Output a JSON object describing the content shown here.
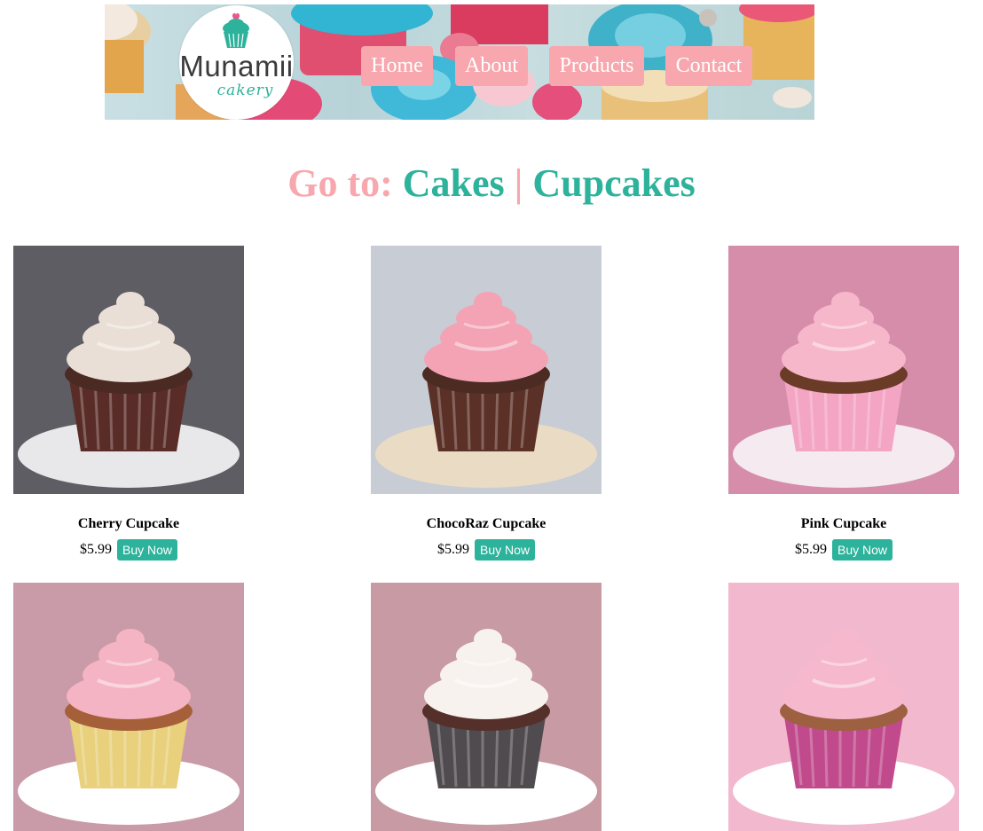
{
  "brand": {
    "name": "Munamii",
    "tagline": "cakery"
  },
  "nav": [
    {
      "label": "Home"
    },
    {
      "label": "About"
    },
    {
      "label": "Products"
    },
    {
      "label": "Contact"
    }
  ],
  "goto": {
    "prefix": "Go to:",
    "links": [
      "Cakes",
      "Cupcakes"
    ],
    "separator": "|"
  },
  "products": [
    {
      "name": "Cherry Cupcake",
      "price": "$5.99",
      "buy_label": "Buy Now",
      "bg": "#5e5d63",
      "frosting": "#eadfd6",
      "liner": "#5a2c27",
      "cake": "#4a2a22",
      "plate": "#e8e8ea"
    },
    {
      "name": "ChocoRaz Cupcake",
      "price": "$5.99",
      "buy_label": "Buy Now",
      "bg": "#c8ccd4",
      "frosting": "#f3a3b4",
      "liner": "#5b3026",
      "cake": "#4c2c22",
      "plate": "#eadcc4"
    },
    {
      "name": "Pink Cupcake",
      "price": "$5.99",
      "buy_label": "Buy Now",
      "bg": "#d58daa",
      "frosting": "#f7b7cb",
      "liner": "#f3a5c3",
      "cake": "#6a3b27",
      "plate": "#f4eaf0"
    },
    {
      "name": "",
      "price": "",
      "buy_label": "",
      "bg": "#c99aa7",
      "frosting": "#f4b4c3",
      "liner": "#e8d07c",
      "cake": "#a5603a",
      "plate": "#ffffff"
    },
    {
      "name": "",
      "price": "",
      "buy_label": "",
      "bg": "#c89aa3",
      "frosting": "#f8f2ee",
      "liner": "#4f4b4e",
      "cake": "#55302a",
      "plate": "#ffffff"
    },
    {
      "name": "",
      "price": "",
      "buy_label": "",
      "bg": "#f2b9ce",
      "frosting": "#f5b8cd",
      "liner": "#c04a8c",
      "cake": "#9d6040",
      "plate": "#ffffff"
    }
  ],
  "colors": {
    "accent_pink": "#f7a7ad",
    "accent_teal": "#2db29b"
  }
}
